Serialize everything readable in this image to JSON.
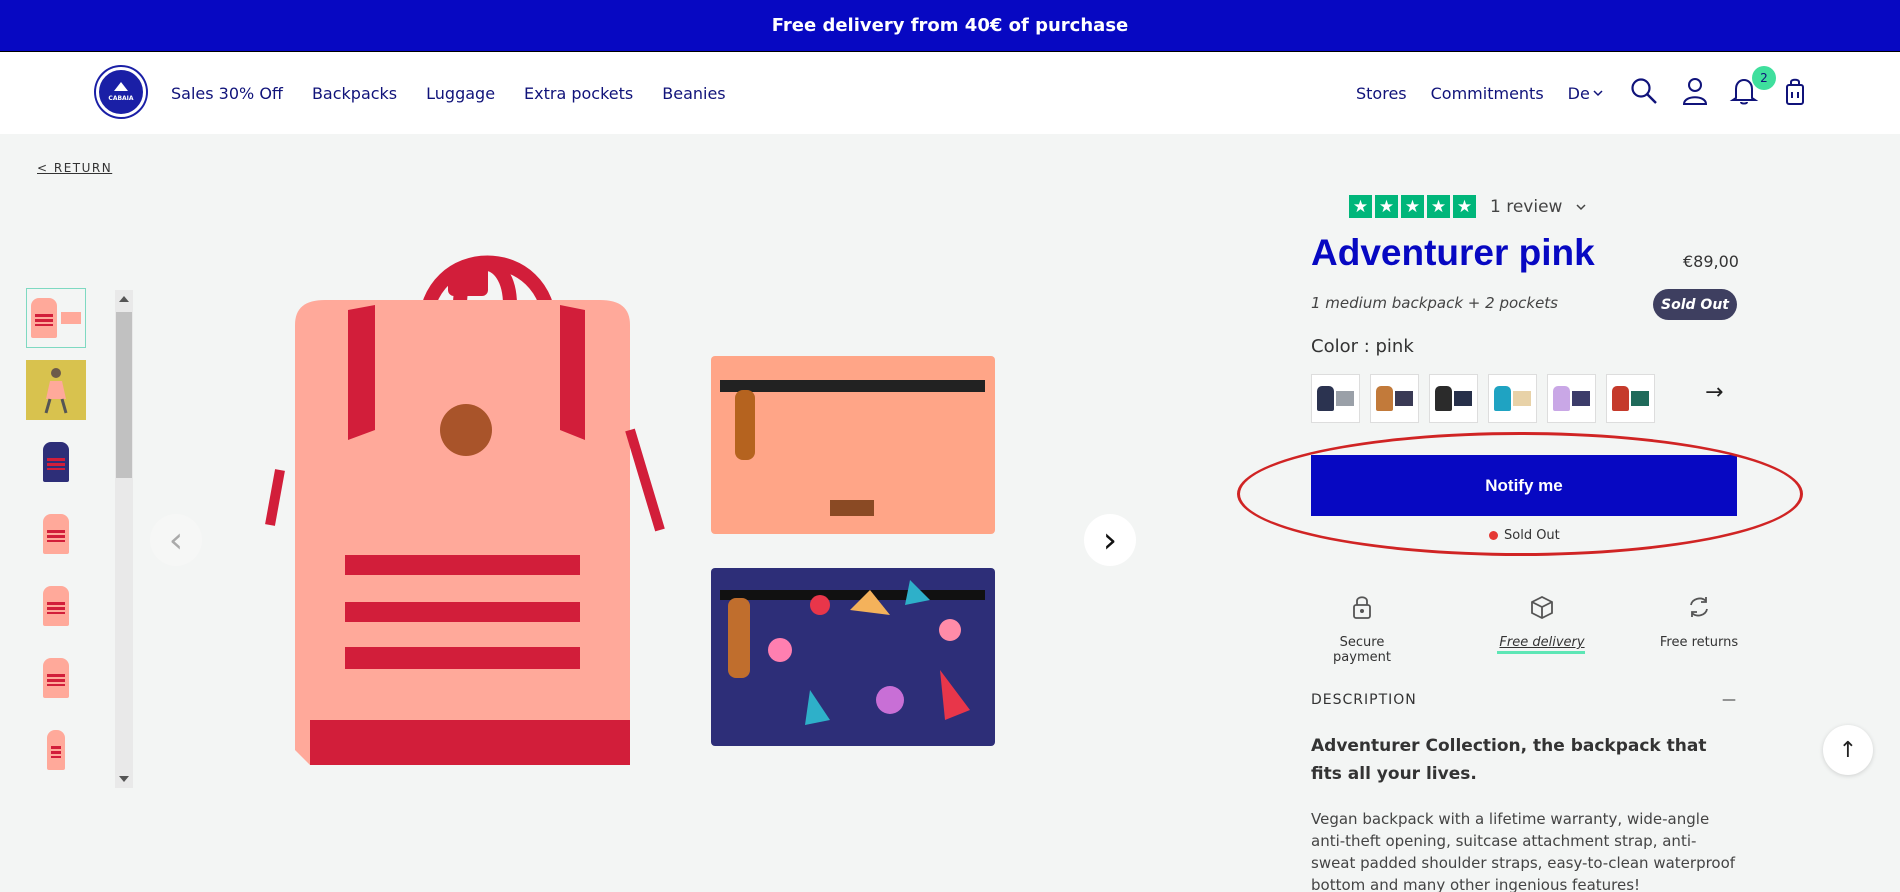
{
  "promo": {
    "text": "Free delivery from 40€ of purchase"
  },
  "header": {
    "logo_text": "CABAIA",
    "nav_left": [
      "Sales 30% Off",
      "Backpacks",
      "Luggage",
      "Extra pockets",
      "Beanies"
    ],
    "nav_right": [
      "Stores",
      "Commitments"
    ],
    "language": "De",
    "notification_count": "2"
  },
  "return_link": "< RETURN",
  "product": {
    "review_label": "1 review",
    "rating_stars": 5,
    "title": "Adventurer pink",
    "price": "€89,00",
    "subtitle": "1 medium backpack + 2 pockets",
    "badge": "Sold Out",
    "color_label": "Color : pink",
    "swatch_colors": [
      "#2b3350",
      "#c27a3a",
      "#2b2b2b",
      "#1fa3c2",
      "#c9a7e6",
      "#c53a2b"
    ],
    "notify_label": "Notify me",
    "stock_status": "Sold Out",
    "features": [
      "Secure payment",
      "Free delivery",
      "Free returns"
    ],
    "description_heading": "DESCRIPTION",
    "description_lead": "Adventurer Collection, the backpack that fits all your lives.",
    "description_body": "Vegan backpack with a lifetime warranty, wide-angle anti-theft opening, suitcase attachment strap, anti-sweat padded shoulder straps, easy-to-clean waterproof bottom and many other ingenious features!"
  },
  "colors": {
    "brand": "#0708c2",
    "accent": "#3fdf9d",
    "trustpilot": "#00b67a",
    "product": "#ffa99a",
    "strap": "#d21e3a"
  }
}
